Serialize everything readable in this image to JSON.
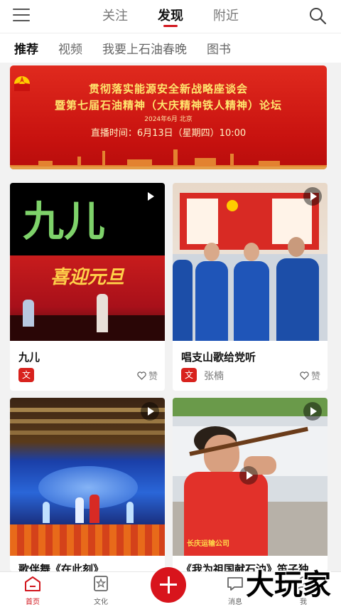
{
  "top_tabs": [
    {
      "label": "关注",
      "active": false
    },
    {
      "label": "发现",
      "active": true
    },
    {
      "label": "附近",
      "active": false
    }
  ],
  "sub_tabs": [
    {
      "label": "推荐",
      "active": true
    },
    {
      "label": "视频",
      "active": false
    },
    {
      "label": "我要上石油春晚",
      "active": false
    },
    {
      "label": "图书",
      "active": false
    }
  ],
  "banner": {
    "line1": "贯彻落实能源安全新战略座谈会",
    "line2": "暨第七届石油精神（大庆精神铁人精神）论坛",
    "date": "2024年6月  北京",
    "time": "直播时间：6月13日（星期四）10:00"
  },
  "cards": [
    {
      "title": "九儿",
      "thumb_text": "九儿",
      "thumb_overlay": "喜迎元旦",
      "author": "",
      "badge": "文",
      "like": "赞"
    },
    {
      "title": "唱支山歌给党听",
      "author": "张楠",
      "badge": "文",
      "like": "赞"
    },
    {
      "title": "歌伴舞《在此刻》",
      "author": "",
      "badge": "",
      "like": ""
    },
    {
      "title": "《我为祖国献石油》笛子独",
      "thumb_text": "长庆运输公司",
      "author": "",
      "badge": "",
      "like": ""
    }
  ],
  "bottom_nav": [
    {
      "label": "首页",
      "active": true
    },
    {
      "label": "文化",
      "active": false
    },
    {
      "label": "消息",
      "active": false
    },
    {
      "label": "我",
      "active": false
    }
  ],
  "watermark": "大玩家",
  "colors": {
    "accent": "#d2161d",
    "banner_red": "#d01a16",
    "banner_gold": "#ffe66e"
  }
}
